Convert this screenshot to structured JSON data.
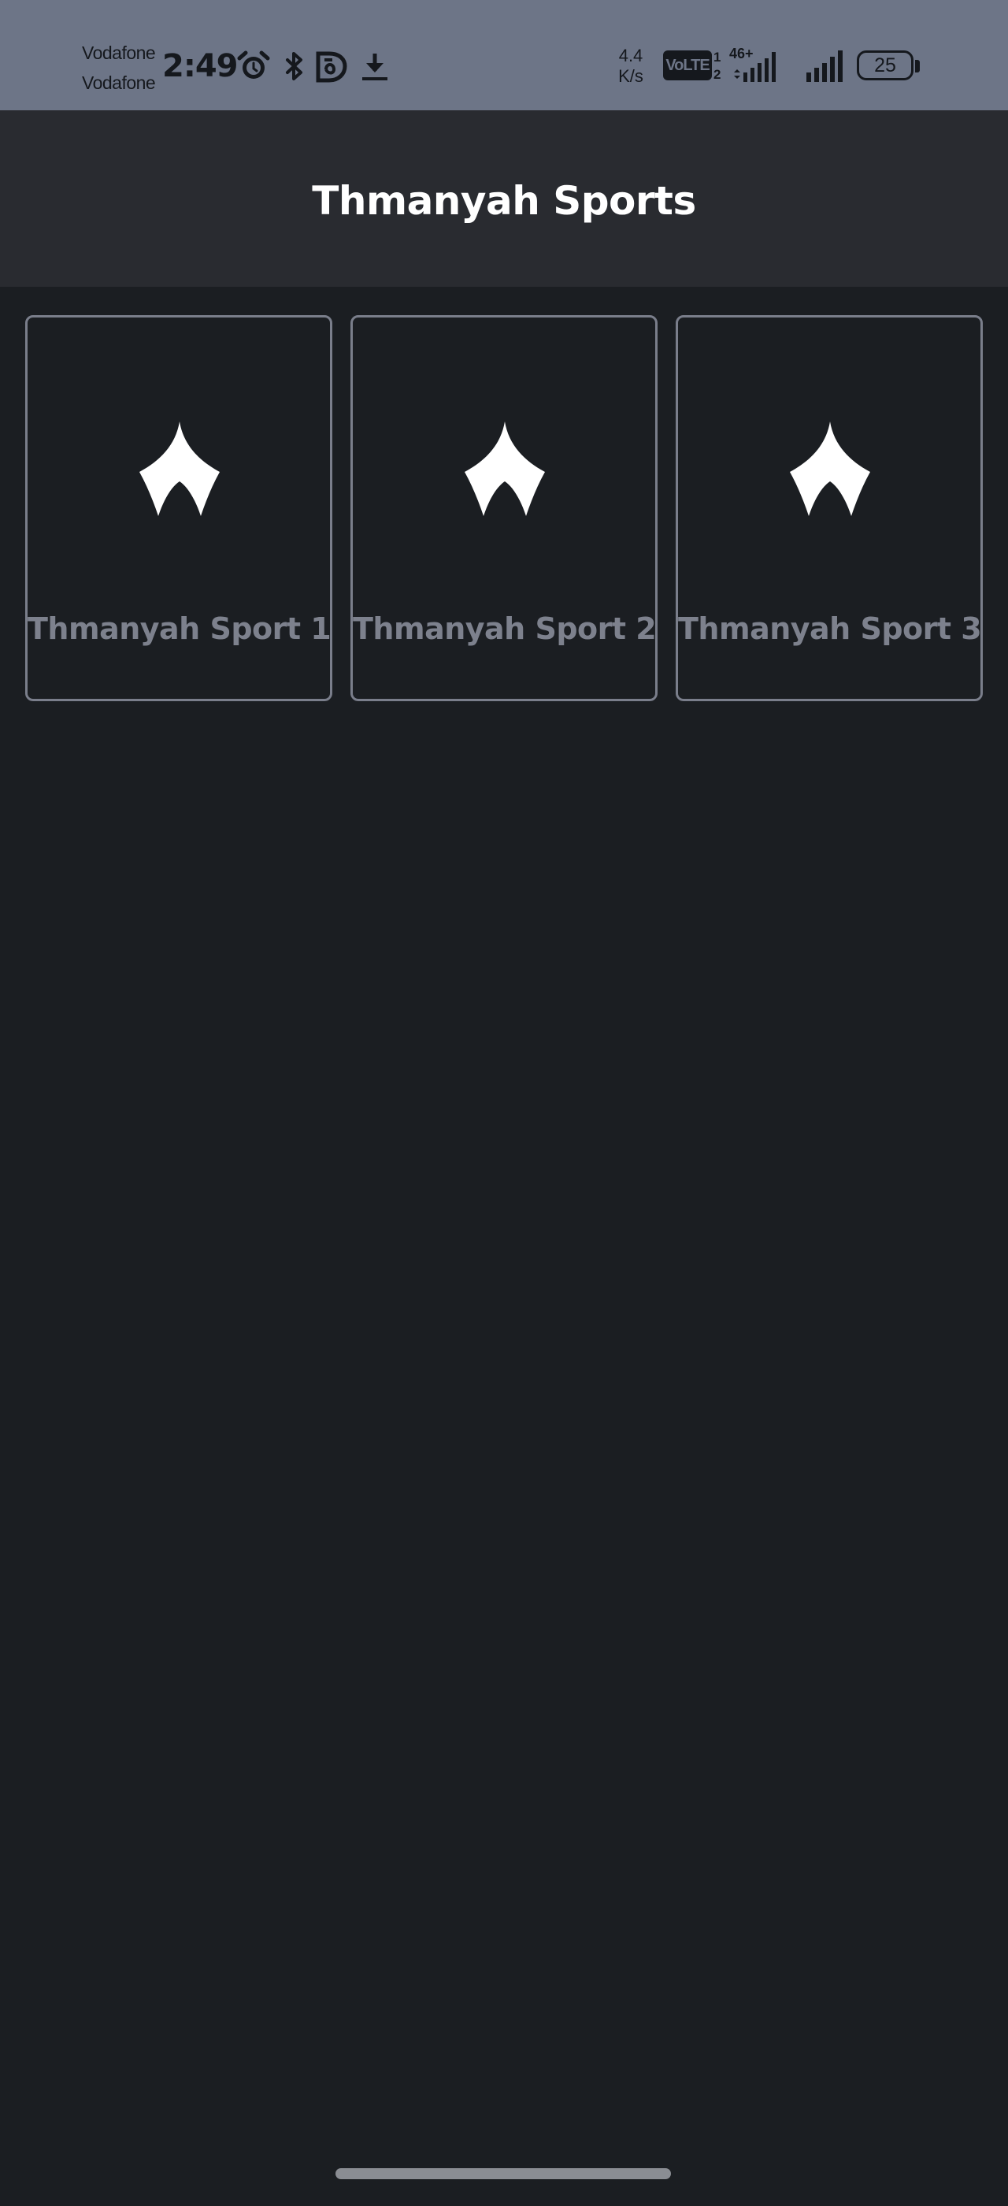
{
  "status_bar": {
    "carrier_1": "Vodafone",
    "carrier_2": "Vodafone",
    "time": "2:49",
    "icons": [
      "alarm-icon",
      "bluetooth-icon",
      "app-notification-icon",
      "download-icon",
      "volte-icon",
      "signal-icon",
      "signal-icon",
      "battery-icon"
    ],
    "speed_value": "4.4",
    "speed_unit": "K/s",
    "volte_label": "VoLTE",
    "sim_1": "1",
    "sim_2": "2",
    "network_type": "46+",
    "battery_level": "25"
  },
  "app_bar": {
    "title": "Thmanyah Sports"
  },
  "channels": [
    {
      "label": "Thmanyah Sport 1",
      "icon": "thmanyah-logo-icon"
    },
    {
      "label": "Thmanyah Sport 2",
      "icon": "thmanyah-logo-icon"
    },
    {
      "label": "Thmanyah Sport 3",
      "icon": "thmanyah-logo-icon"
    }
  ],
  "colors": {
    "status_bar_bg": "#6d7587",
    "app_bar_bg": "#292b30",
    "page_bg": "#1b1e22",
    "card_border": "#7a7e8b",
    "card_label": "#7d818d",
    "title": "#ffffff"
  }
}
